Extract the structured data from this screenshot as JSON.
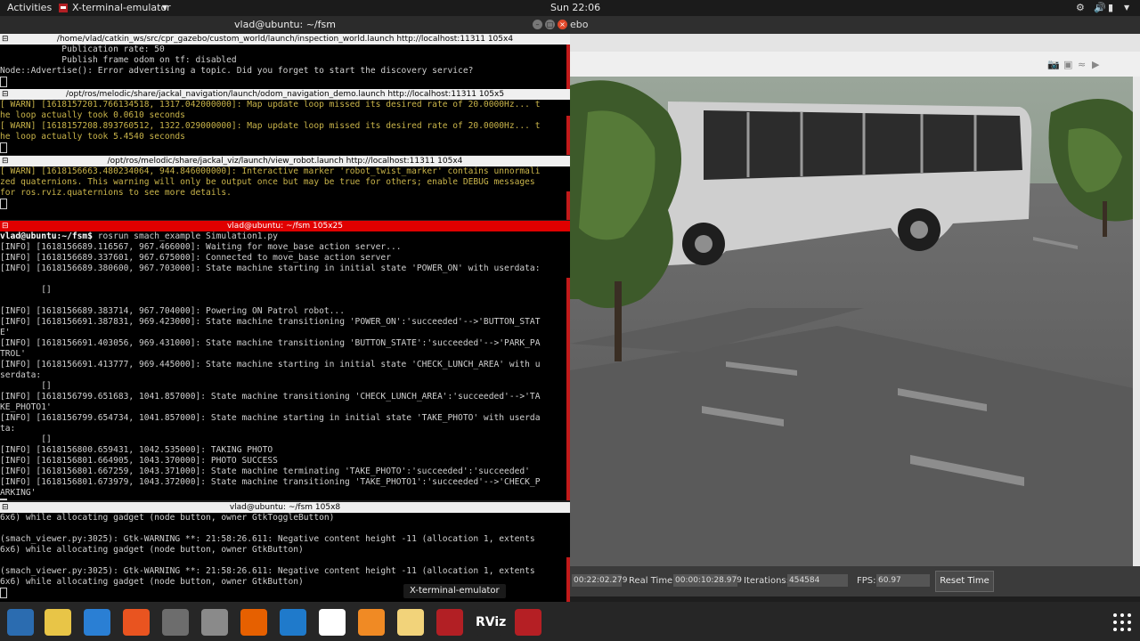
{
  "topbar": {
    "activities": "Activities",
    "app_name": "X-terminal-emulator",
    "clock": "Sun 22:06"
  },
  "main_window": {
    "title": "vlad@ubuntu: ~/fsm"
  },
  "gazebo": {
    "title_fragment": "ebo",
    "sim_time": "00:22:02.279",
    "real_time_label": "Real Time:",
    "real_time": "00:00:10:28.979",
    "iterations_label": "Iterations:",
    "iterations": "454584",
    "fps_label": "FPS:",
    "fps": "60.97",
    "reset_label": "Reset Time"
  },
  "terminals": [
    {
      "header": "/home/vlad/catkin_ws/src/cpr_gazebo/custom_world/launch/inspection_world.launch http://localhost:11311 105x4",
      "lines": [
        "            Publication rate: 50",
        "            Publish frame odom on tf: disabled",
        "Node::Advertise(): Error advertising a topic. Did you forget to start the discovery service?"
      ]
    },
    {
      "header": "/opt/ros/melodic/share/jackal_navigation/launch/odom_navigation_demo.launch http://localhost:11311 105x5",
      "lines": [
        "[ WARN] [1618157201.766134518, 1317.042000000]: Map update loop missed its desired rate of 20.0000Hz... t",
        "he loop actually took 0.0610 seconds",
        "[ WARN] [1618157208.893760512, 1322.029000000]: Map update loop missed its desired rate of 20.0000Hz... t",
        "he loop actually took 5.4540 seconds"
      ]
    },
    {
      "header": "/opt/ros/melodic/share/jackal_viz/launch/view_robot.launch http://localhost:11311 105x4",
      "lines": [
        "[ WARN] [1618156663.480234064, 944.846000000]: Interactive marker 'robot_twist_marker' contains unnormali",
        "zed quaternions. This warning will only be output once but may be true for others; enable DEBUG messages",
        "for ros.rviz.quaternions to see more details."
      ]
    },
    {
      "header": "vlad@ubuntu: ~/fsm 105x25",
      "prompt": "vlad@ubuntu:~/fsm$",
      "command": " rosrun smach_example Simulation1.py",
      "lines": [
        "[INFO] [1618156689.116567, 967.466000]: Waiting for move_base action server...",
        "[INFO] [1618156689.337601, 967.675000]: Connected to move_base action server",
        "[INFO] [1618156689.380600, 967.703000]: State machine starting in initial state 'POWER_ON' with userdata:",
        "",
        "        []",
        "",
        "[INFO] [1618156689.383714, 967.704000]: Powering ON Patrol robot...",
        "[INFO] [1618156691.387831, 969.423000]: State machine transitioning 'POWER_ON':'succeeded'-->'BUTTON_STAT",
        "E'",
        "[INFO] [1618156691.403056, 969.431000]: State machine transitioning 'BUTTON_STATE':'succeeded'-->'PARK_PA",
        "TROL'",
        "[INFO] [1618156691.413777, 969.445000]: State machine starting in initial state 'CHECK_LUNCH_AREA' with u",
        "serdata:",
        "        []",
        "[INFO] [1618156799.651683, 1041.857000]: State machine transitioning 'CHECK_LUNCH_AREA':'succeeded'-->'TA",
        "KE_PHOTO1'",
        "[INFO] [1618156799.654734, 1041.857000]: State machine starting in initial state 'TAKE_PHOTO' with userda",
        "ta:",
        "        []",
        "[INFO] [1618156800.659431, 1042.535000]: TAKING PHOTO",
        "[INFO] [1618156801.664905, 1043.370000]: PHOTO SUCCESS",
        "[INFO] [1618156801.667259, 1043.371000]: State machine terminating 'TAKE_PHOTO':'succeeded':'succeeded'",
        "[INFO] [1618156801.673979, 1043.372000]: State machine transitioning 'TAKE_PHOTO1':'succeeded'-->'CHECK_P",
        "ARKING'"
      ]
    },
    {
      "header": "vlad@ubuntu: ~/fsm 105x8",
      "lines": [
        "6x6) while allocating gadget (node button, owner GtkToggleButton)",
        "",
        "(smach_viewer.py:3025): Gtk-WARNING **: 21:58:26.611: Negative content height -11 (allocation 1, extents",
        "6x6) while allocating gadget (node button, owner GtkButton)",
        "",
        "(smach_viewer.py:3025): Gtk-WARNING **: 21:58:26.611: Negative content height -11 (allocation 1, extents",
        "6x6) while allocating gadget (node button, owner GtkButton)"
      ]
    }
  ],
  "tooltip": "X-terminal-emulator",
  "dock": {
    "apps": [
      {
        "name": "thunderbird-icon",
        "color": "#2b6cb0"
      },
      {
        "name": "rhythmbox-icon",
        "color": "#e8c547"
      },
      {
        "name": "libreoffice-writer-icon",
        "color": "#2a7fd4"
      },
      {
        "name": "ubuntu-software-icon",
        "color": "#e95420"
      },
      {
        "name": "files-icon",
        "color": "#6d6d6d"
      },
      {
        "name": "screenshot-icon",
        "color": "#8a8a8a"
      },
      {
        "name": "firefox-icon",
        "color": "#e66000"
      },
      {
        "name": "vscode-icon",
        "color": "#1f7acb"
      },
      {
        "name": "pdf-viewer-icon",
        "color": "#ffffff"
      },
      {
        "name": "ros-box-icon",
        "color": "#f08a24"
      },
      {
        "name": "text-editor-icon",
        "color": "#f2d37a"
      },
      {
        "name": "terminal-emulator-icon",
        "color": "#b21f24"
      },
      {
        "name": "rviz-icon",
        "color": "#262626"
      },
      {
        "name": "gazebo-icon",
        "color": "#b51f24"
      }
    ],
    "rviz_label": "RViz"
  }
}
